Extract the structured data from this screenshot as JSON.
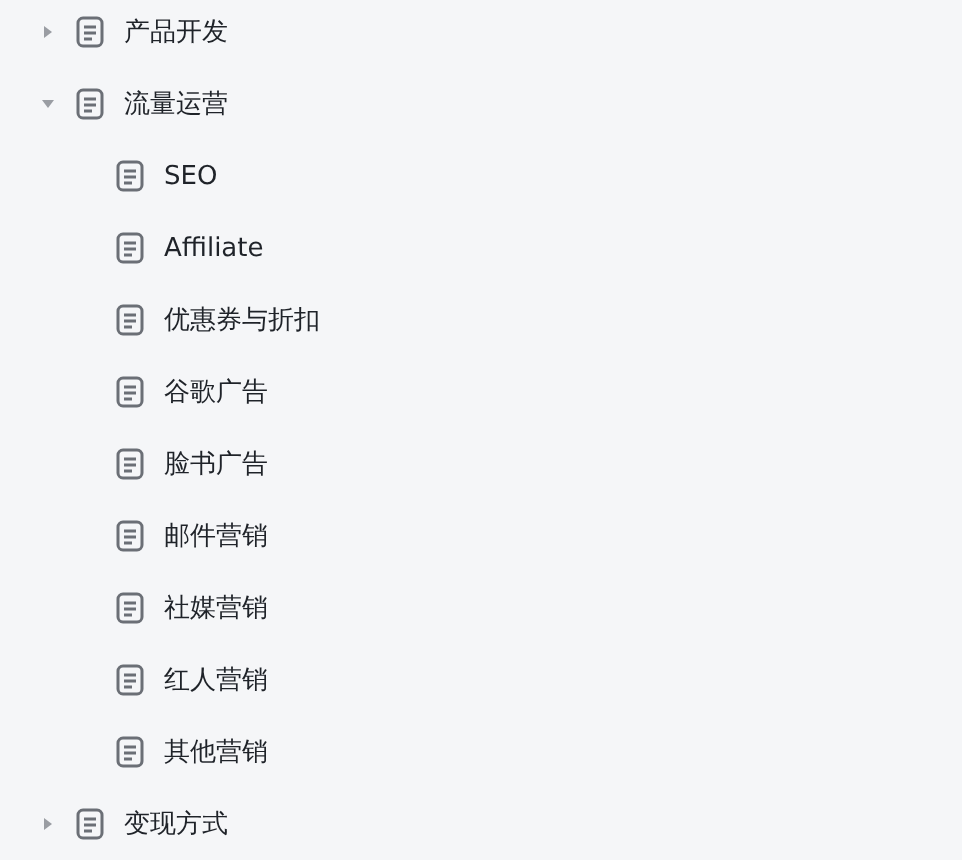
{
  "tree": [
    {
      "label": "产品开发",
      "expanded": false
    },
    {
      "label": "流量运营",
      "expanded": true,
      "children": [
        {
          "label": "SEO"
        },
        {
          "label": "Affiliate"
        },
        {
          "label": "优惠券与折扣"
        },
        {
          "label": "谷歌广告"
        },
        {
          "label": "脸书广告"
        },
        {
          "label": "邮件营销"
        },
        {
          "label": "社媒营销"
        },
        {
          "label": "红人营销"
        },
        {
          "label": "其他营销"
        }
      ]
    },
    {
      "label": "变现方式",
      "expanded": false
    }
  ]
}
